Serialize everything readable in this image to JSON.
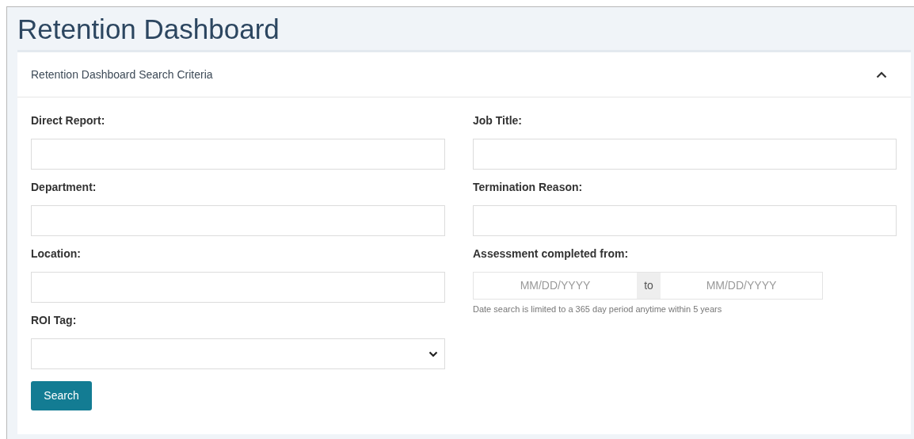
{
  "page_title": "Retention Dashboard",
  "panel": {
    "title": "Retention Dashboard Search Criteria",
    "expanded": true
  },
  "left_fields": [
    {
      "kind": "text",
      "label": "Direct Report:"
    },
    {
      "kind": "text",
      "label": "Department:"
    },
    {
      "kind": "text",
      "label": "Location:"
    },
    {
      "kind": "select",
      "label": "ROI Tag:"
    }
  ],
  "right_fields": [
    {
      "kind": "text",
      "label": "Job Title:"
    },
    {
      "kind": "text",
      "label": "Termination Reason:"
    },
    {
      "kind": "daterange",
      "label": "Assessment completed from:",
      "from_placeholder": "MM/DD/YYYY",
      "separator": "to",
      "to_placeholder": "MM/DD/YYYY",
      "help": "Date search is limited to a 365 day period anytime within 5 years"
    }
  ],
  "search_button": "Search"
}
